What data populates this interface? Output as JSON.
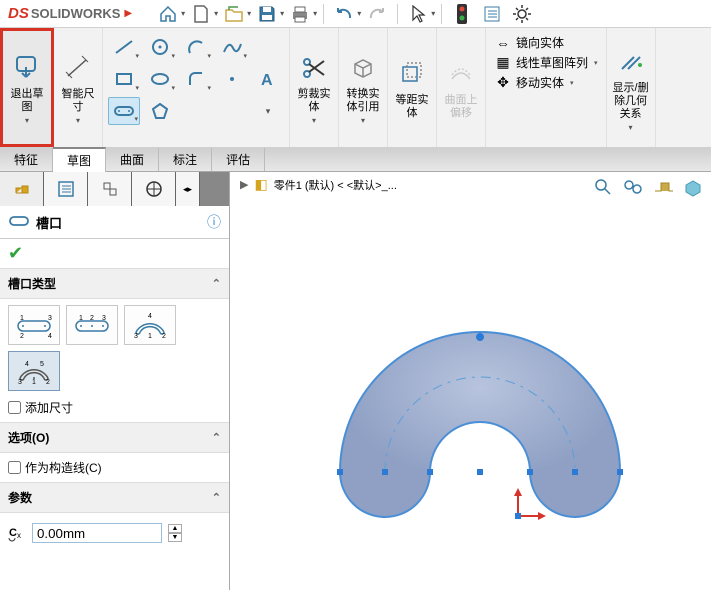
{
  "brand": {
    "logo": "DS",
    "name": "SOLIDWORKS"
  },
  "topbar": {
    "items": [
      "home-icon",
      "new-icon",
      "open-icon",
      "save-icon",
      "print-icon",
      "undo-icon",
      "redo-icon",
      "select-icon"
    ]
  },
  "ribbon": {
    "exit_sketch": "退出草\n图",
    "smart_dim": "智能尺\n寸",
    "trim": {
      "label": "剪裁实\n体"
    },
    "convert": {
      "label": "转换实\n体引用"
    },
    "offset": {
      "label": "等距实\n体"
    },
    "surface_offset": {
      "label": "曲面上\n偏移"
    },
    "mirror": "镜向实体",
    "linear_pattern": "线性草图阵列",
    "move": "移动实体",
    "display_relations": "显示/删\n除几何\n关系"
  },
  "tabs": [
    "特征",
    "草图",
    "曲面",
    "标注",
    "评估"
  ],
  "active_tab": "草图",
  "doc_crumb": "零件1 (默认) < <默认>_...",
  "property_panel": {
    "title": "槽口",
    "section_type": "槽口类型",
    "add_dim": "添加尺寸",
    "options": "选项(O)",
    "construction": "作为构造线(C)",
    "params": "参数",
    "param_value": "0.00mm"
  }
}
